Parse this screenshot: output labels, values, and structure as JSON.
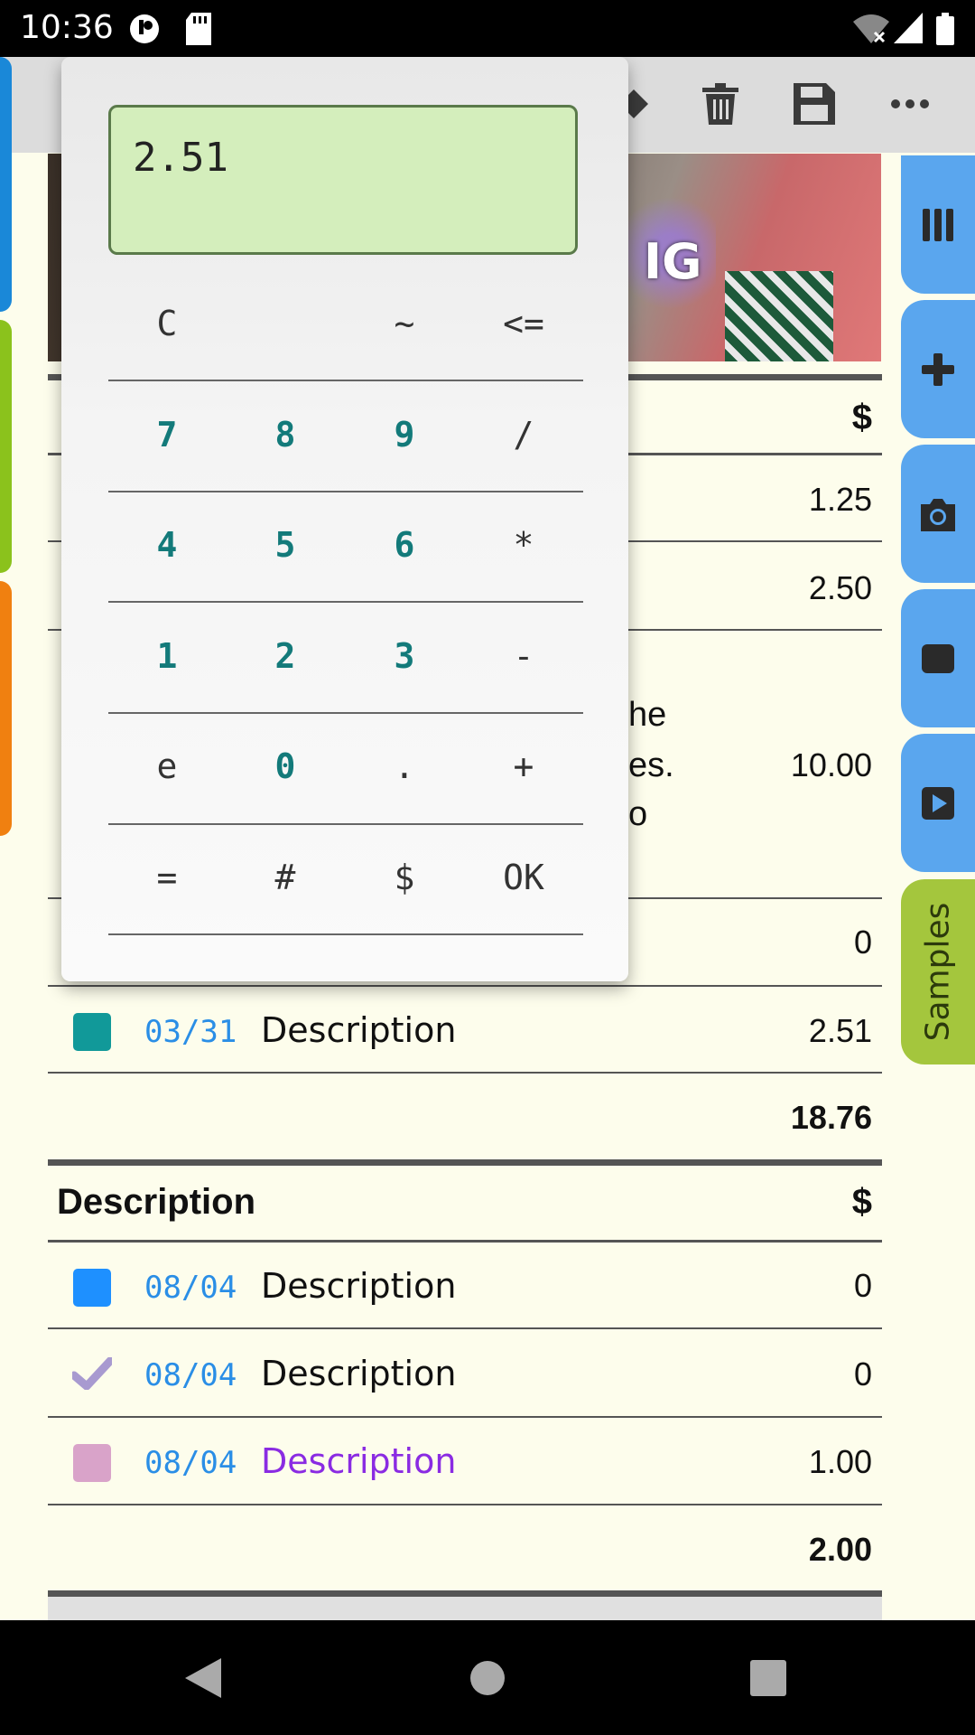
{
  "status_bar": {
    "time": "10:36"
  },
  "toolbar": {
    "icons": [
      "undo-icon",
      "trash-icon",
      "save-icon",
      "more-icon"
    ]
  },
  "side_tabs": {
    "left_colors": [
      "#1a88d8",
      "#8bc21c",
      "#f08010"
    ],
    "right": [
      "columns-icon",
      "plus-icon",
      "camera-icon",
      "stop-icon",
      "play-icon"
    ],
    "samples_label": "Samples"
  },
  "photo": {
    "visible_text": "IG"
  },
  "table1": {
    "header_currency": "$",
    "rows": [
      {
        "amount": "1.25"
      },
      {
        "amount": "2.50"
      },
      {
        "desc_fragments": [
          "he",
          "es.",
          "o"
        ],
        "amount": "10.00"
      },
      {
        "amount": "0"
      },
      {
        "color": "#119999",
        "date": "03/31",
        "description": "Description",
        "amount": "2.51"
      }
    ],
    "total": "18.76"
  },
  "table2": {
    "header_desc": "Description",
    "header_currency": "$",
    "rows": [
      {
        "marker": "square",
        "color": "#1e90ff",
        "date": "08/04",
        "description": "Description",
        "amount": "0"
      },
      {
        "marker": "check",
        "color": "#a89ad0",
        "date": "08/04",
        "description": "Description",
        "amount": "0"
      },
      {
        "marker": "square",
        "color": "#d9a3c9",
        "date": "08/04",
        "description": "Description",
        "amount": "1.00",
        "desc_color": "#8a2be2"
      }
    ],
    "total": "2.00"
  },
  "calculator": {
    "display": "2.51",
    "keys": [
      [
        "C",
        "",
        "~",
        "<="
      ],
      [
        "7",
        "8",
        "9",
        "/"
      ],
      [
        "4",
        "5",
        "6",
        "*"
      ],
      [
        "1",
        "2",
        "3",
        "-"
      ],
      [
        "e",
        "0",
        ".",
        "+"
      ],
      [
        "=",
        "#",
        "$",
        "OK"
      ]
    ]
  }
}
